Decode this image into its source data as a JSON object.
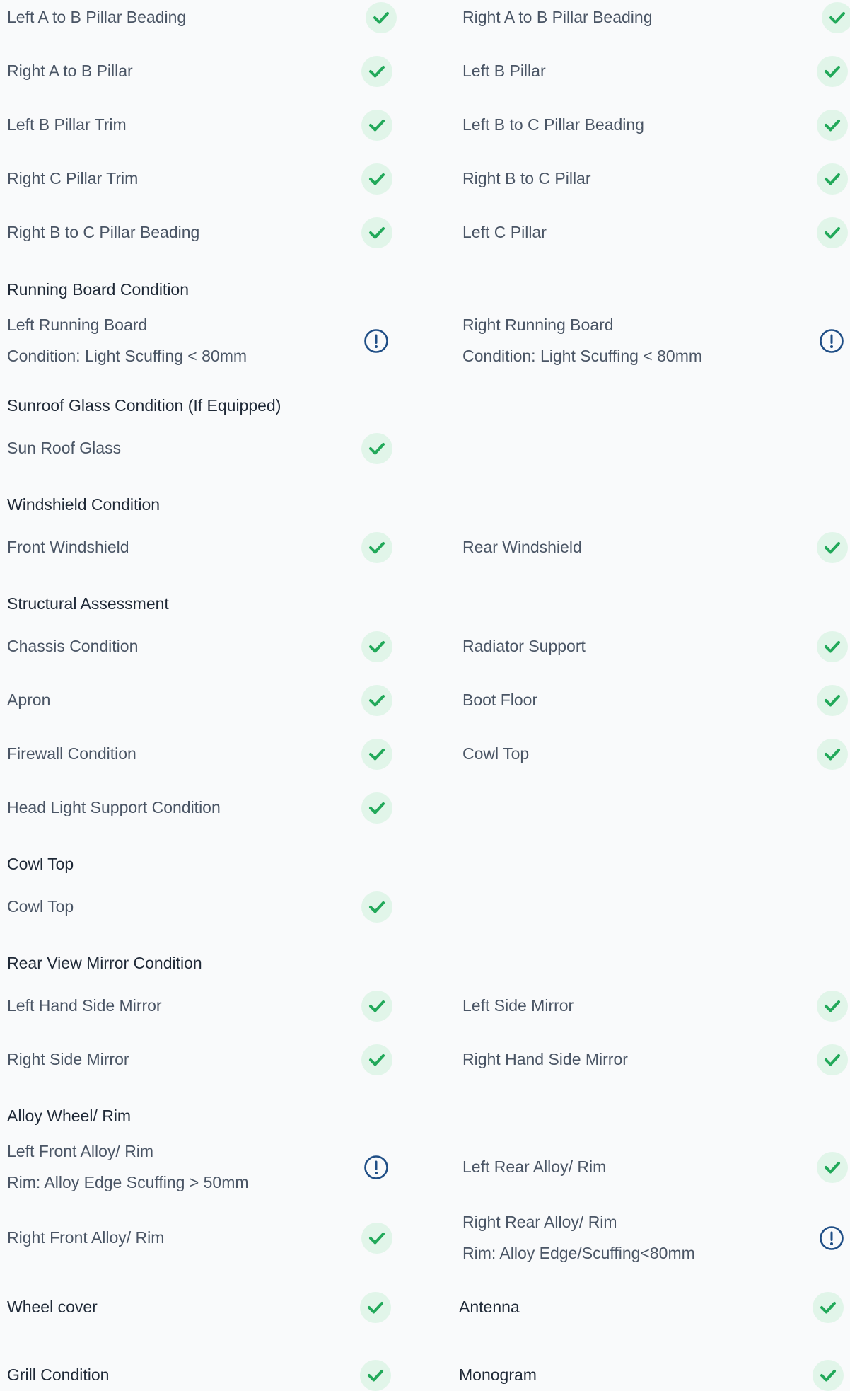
{
  "colors": {
    "background": "#f9fafb",
    "text_muted": "#4a5565",
    "text_dark": "#1f2937",
    "ok_fill": "#e1f5e9",
    "ok_check": "#22a95a",
    "warn_stroke": "#1f4e86"
  },
  "icons": {
    "ok": "check-circle-icon",
    "warn": "exclamation-circle-icon"
  },
  "rows": {
    "pillars": {
      "r1": {
        "left": "Left A to B Pillar Beading",
        "right": "Right A to B Pillar Beading"
      },
      "r2": {
        "left": "Right A to B Pillar",
        "right": "Left B Pillar"
      },
      "r3": {
        "left": "Left B Pillar Trim",
        "right": "Left B to C Pillar Beading"
      },
      "r4": {
        "left": "Right C Pillar Trim",
        "right": "Right B to C Pillar"
      },
      "r5": {
        "left": "Right B to C Pillar Beading",
        "right": "Left C Pillar"
      }
    }
  },
  "sections": {
    "running_board": {
      "heading": "Running Board Condition",
      "left": {
        "label": "Left Running Board",
        "detail": "Condition: Light Scuffing < 80mm",
        "status": "warn"
      },
      "right": {
        "label": "Right Running Board",
        "detail": "Condition: Light Scuffing < 80mm",
        "status": "warn"
      }
    },
    "sunroof": {
      "heading": "Sunroof Glass Condition (If Equipped)",
      "left": {
        "label": "Sun Roof Glass",
        "status": "ok"
      }
    },
    "windshield": {
      "heading": "Windshield Condition",
      "left": {
        "label": "Front Windshield",
        "status": "ok"
      },
      "right": {
        "label": "Rear Windshield",
        "status": "ok"
      }
    },
    "structural": {
      "heading": "Structural Assessment",
      "r1": {
        "left": "Chassis Condition",
        "right": "Radiator Support"
      },
      "r2": {
        "left": "Apron",
        "right": "Boot Floor"
      },
      "r3": {
        "left": "Firewall Condition",
        "right": "Cowl Top"
      },
      "r4": {
        "left": "Head Light Support Condition"
      }
    },
    "cowl": {
      "heading": "Cowl Top",
      "left": {
        "label": "Cowl Top",
        "status": "ok"
      }
    },
    "mirror": {
      "heading": "Rear View Mirror Condition",
      "r1": {
        "left": "Left Hand Side Mirror",
        "right": "Left Side Mirror"
      },
      "r2": {
        "left": "Right Side Mirror",
        "right": "Right Hand Side Mirror"
      }
    },
    "alloy": {
      "heading": "Alloy Wheel/ Rim",
      "front_left": {
        "label": "Left Front Alloy/ Rim",
        "detail": "Rim: Alloy Edge Scuffing > 50mm",
        "status": "warn"
      },
      "rear_left": {
        "label": "Left Rear Alloy/ Rim",
        "status": "ok"
      },
      "front_right": {
        "label": "Right Front Alloy/ Rim",
        "status": "ok"
      },
      "rear_right": {
        "label": "Right Rear Alloy/ Rim",
        "detail": "Rim: Alloy Edge/Scuffing<80mm",
        "status": "warn"
      }
    },
    "extras": {
      "r1": {
        "left": "Wheel cover",
        "right": "Antenna"
      },
      "r2": {
        "left": "Grill Condition",
        "right": "Monogram"
      }
    }
  }
}
